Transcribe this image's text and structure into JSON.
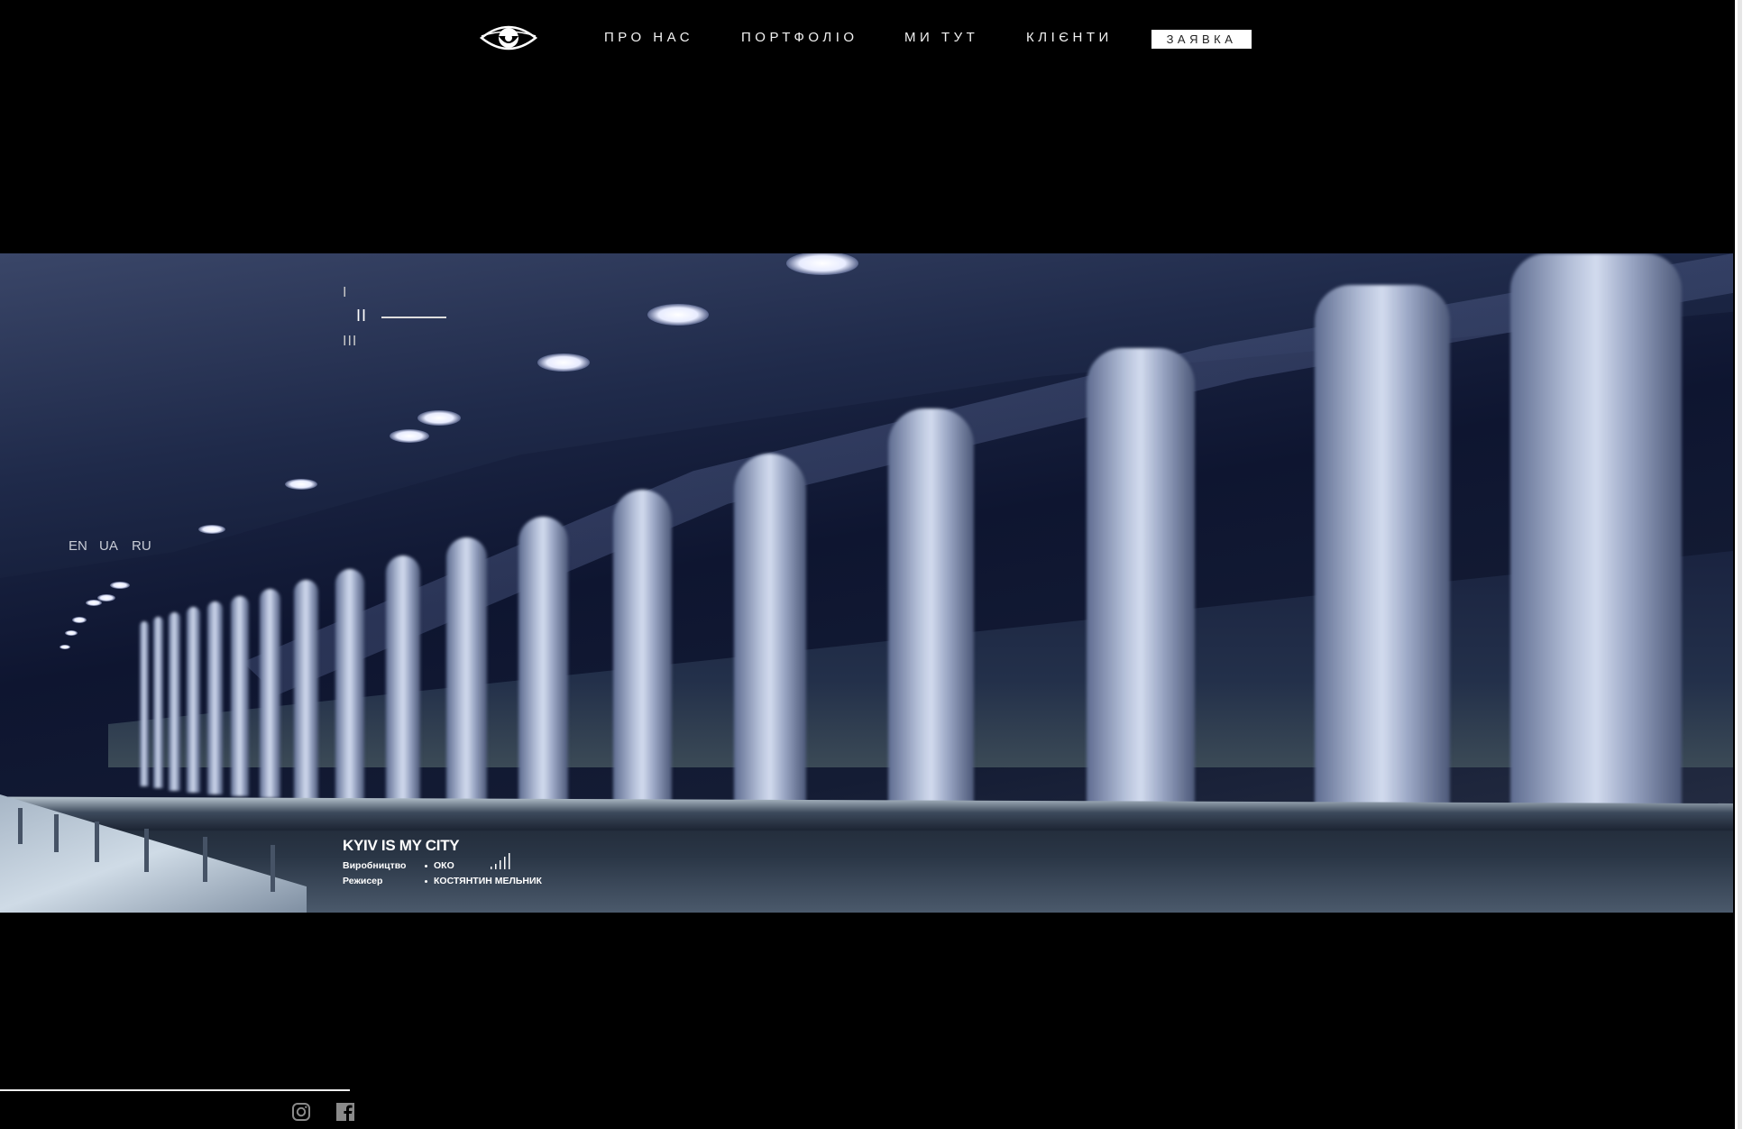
{
  "header": {
    "logo_icon": "eye-icon",
    "nav": [
      {
        "label": "ПРО НАС"
      },
      {
        "label": "ПОРТФОЛІО"
      },
      {
        "label": "МИ ТУТ"
      },
      {
        "label": "КЛІЄНТИ"
      }
    ],
    "cta_label": "ЗАЯВКА"
  },
  "slider": {
    "indices": [
      "I",
      "II",
      "III"
    ],
    "active_index": 2
  },
  "languages": [
    "EN",
    "UA",
    "RU"
  ],
  "project": {
    "title": "KYIV IS MY CITY",
    "production_label": "Виробництво",
    "production_value": "ОКО",
    "director_label": "Режисер",
    "director_value": "КОСТЯНТИН МЕЛЬНИК",
    "volume_icon": "volume-bars-icon"
  },
  "footer": {
    "social_icons": [
      "instagram-icon",
      "facebook-icon"
    ]
  },
  "colors": {
    "background": "#000000",
    "cta_bg": "#ffffff",
    "text": "#ffffff"
  }
}
